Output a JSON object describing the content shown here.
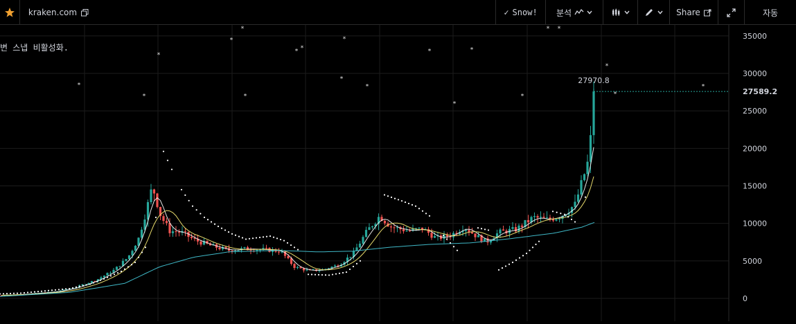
{
  "toolbar": {
    "site": "kraken.com",
    "snow_label": "Snow!",
    "snow_check": "✓",
    "analysis_label": "분석",
    "share_label": "Share",
    "auto_label": "자동"
  },
  "note": {
    "text": "변 스냅 비활성화."
  },
  "colors": {
    "background": "#000000",
    "up": "#26a69a",
    "down": "#ef5350",
    "sma_short": "#ffffff",
    "sma_mid": "#e6d96b",
    "sma_long": "#3fb8c7",
    "price_line": "#26a69a"
  },
  "chart_data": {
    "type": "candlestick",
    "x_range": [
      0,
      1050
    ],
    "ylim": [
      0,
      36000
    ],
    "yticks": [
      0,
      5000,
      10000,
      15000,
      20000,
      25000,
      30000,
      35000
    ],
    "ytick_labels": [
      "0",
      "5000",
      "10000",
      "15000",
      "20000",
      "25000",
      "30000",
      "35000"
    ],
    "high_label": "27970.8",
    "high_value": 27970.8,
    "last_label": "27589.2",
    "last_value": 27589.2,
    "grid": true,
    "price_anchors": [
      [
        0,
        400
      ],
      [
        40,
        600
      ],
      [
        80,
        900
      ],
      [
        110,
        1500
      ],
      [
        140,
        2500
      ],
      [
        165,
        3800
      ],
      [
        185,
        5500
      ],
      [
        200,
        8000
      ],
      [
        212,
        12000
      ],
      [
        220,
        15000
      ],
      [
        232,
        11000
      ],
      [
        245,
        9000
      ],
      [
        262,
        8800
      ],
      [
        280,
        7800
      ],
      [
        305,
        7000
      ],
      [
        330,
        6400
      ],
      [
        355,
        6600
      ],
      [
        380,
        6500
      ],
      [
        405,
        6300
      ],
      [
        425,
        4200
      ],
      [
        445,
        3700
      ],
      [
        465,
        3800
      ],
      [
        490,
        4500
      ],
      [
        510,
        6000
      ],
      [
        530,
        9000
      ],
      [
        548,
        11000
      ],
      [
        565,
        9500
      ],
      [
        590,
        9000
      ],
      [
        610,
        9300
      ],
      [
        630,
        8000
      ],
      [
        650,
        8400
      ],
      [
        670,
        9500
      ],
      [
        688,
        8300
      ],
      [
        702,
        7500
      ],
      [
        720,
        8800
      ],
      [
        745,
        9200
      ],
      [
        770,
        10800
      ],
      [
        790,
        10500
      ],
      [
        810,
        11000
      ],
      [
        830,
        12500
      ],
      [
        840,
        15500
      ],
      [
        848,
        18000
      ],
      [
        855,
        23000
      ],
      [
        860,
        27589
      ]
    ],
    "sma_long_anchors": [
      [
        0,
        250
      ],
      [
        100,
        800
      ],
      [
        180,
        2000
      ],
      [
        230,
        4200
      ],
      [
        280,
        5500
      ],
      [
        330,
        6200
      ],
      [
        400,
        6400
      ],
      [
        460,
        6200
      ],
      [
        510,
        6300
      ],
      [
        560,
        6800
      ],
      [
        620,
        7200
      ],
      [
        680,
        7400
      ],
      [
        740,
        8000
      ],
      [
        800,
        8700
      ],
      [
        840,
        9500
      ],
      [
        860,
        10200
      ]
    ],
    "sar_dots": [
      [
        0,
        600
      ],
      [
        30,
        700
      ],
      [
        60,
        950
      ],
      [
        100,
        1300
      ],
      [
        130,
        1900
      ],
      [
        150,
        2600
      ],
      [
        175,
        3600
      ],
      [
        195,
        4800
      ],
      [
        210,
        6800
      ],
      [
        225,
        10800
      ],
      [
        236,
        19600
      ],
      [
        248,
        17200
      ],
      [
        262,
        14500
      ],
      [
        278,
        12300
      ],
      [
        295,
        10800
      ],
      [
        315,
        9600
      ],
      [
        335,
        8600
      ],
      [
        355,
        7900
      ],
      [
        390,
        8300
      ],
      [
        410,
        7700
      ],
      [
        430,
        6500
      ],
      [
        445,
        3200
      ],
      [
        475,
        3100
      ],
      [
        500,
        3500
      ],
      [
        520,
        5000
      ],
      [
        555,
        13800
      ],
      [
        580,
        13000
      ],
      [
        600,
        12300
      ],
      [
        620,
        11000
      ],
      [
        640,
        8400
      ],
      [
        660,
        6400
      ],
      [
        690,
        9400
      ],
      [
        705,
        9100
      ],
      [
        720,
        3800
      ],
      [
        740,
        4800
      ],
      [
        760,
        6000
      ],
      [
        778,
        7600
      ],
      [
        798,
        11600
      ],
      [
        815,
        11200
      ],
      [
        830,
        10200
      ],
      [
        845,
        13500
      ],
      [
        858,
        17000
      ]
    ],
    "snow_points": [
      [
        114,
        28500
      ],
      [
        208,
        27000
      ],
      [
        229,
        32500
      ],
      [
        334,
        34500
      ],
      [
        350,
        36000
      ],
      [
        354,
        27000
      ],
      [
        428,
        33000
      ],
      [
        436,
        33400
      ],
      [
        493,
        29300
      ],
      [
        497,
        34600
      ],
      [
        530,
        28300
      ],
      [
        620,
        33000
      ],
      [
        656,
        26000
      ],
      [
        681,
        33200
      ],
      [
        754,
        27000
      ],
      [
        791,
        36000
      ],
      [
        807,
        36000
      ],
      [
        876,
        31000
      ],
      [
        888,
        27300
      ],
      [
        1015,
        28300
      ]
    ]
  }
}
